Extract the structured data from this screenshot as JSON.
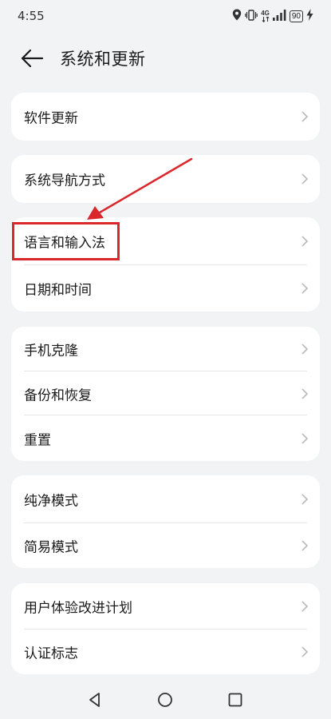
{
  "status_bar": {
    "time": "4:55",
    "battery": "90",
    "network": "4G",
    "icons": [
      "location-icon",
      "vibrate-icon",
      "network-4g-icon",
      "signal-icon",
      "battery-icon",
      "charging-icon"
    ]
  },
  "header": {
    "title": "系统和更新",
    "back_icon": "back-arrow-icon"
  },
  "groups": [
    {
      "items": [
        {
          "label": "软件更新"
        }
      ]
    },
    {
      "items": [
        {
          "label": "系统导航方式"
        }
      ]
    },
    {
      "items": [
        {
          "label": "语言和输入法"
        },
        {
          "label": "日期和时间"
        }
      ]
    },
    {
      "items": [
        {
          "label": "手机克隆"
        },
        {
          "label": "备份和恢复"
        },
        {
          "label": "重置"
        }
      ]
    },
    {
      "items": [
        {
          "label": "纯净模式"
        },
        {
          "label": "简易模式"
        }
      ]
    },
    {
      "items": [
        {
          "label": "用户体验改进计划"
        },
        {
          "label": "认证标志"
        }
      ]
    }
  ],
  "annotation": {
    "color": "#d9272b",
    "target": "语言和输入法"
  },
  "nav_bar": {
    "icons": [
      "back-triangle-icon",
      "home-circle-icon",
      "recents-square-icon"
    ]
  },
  "colors": {
    "background": "#f1f3f5",
    "card": "#ffffff",
    "text": "#1a1a1a",
    "chevron": "#b8b8b8"
  }
}
